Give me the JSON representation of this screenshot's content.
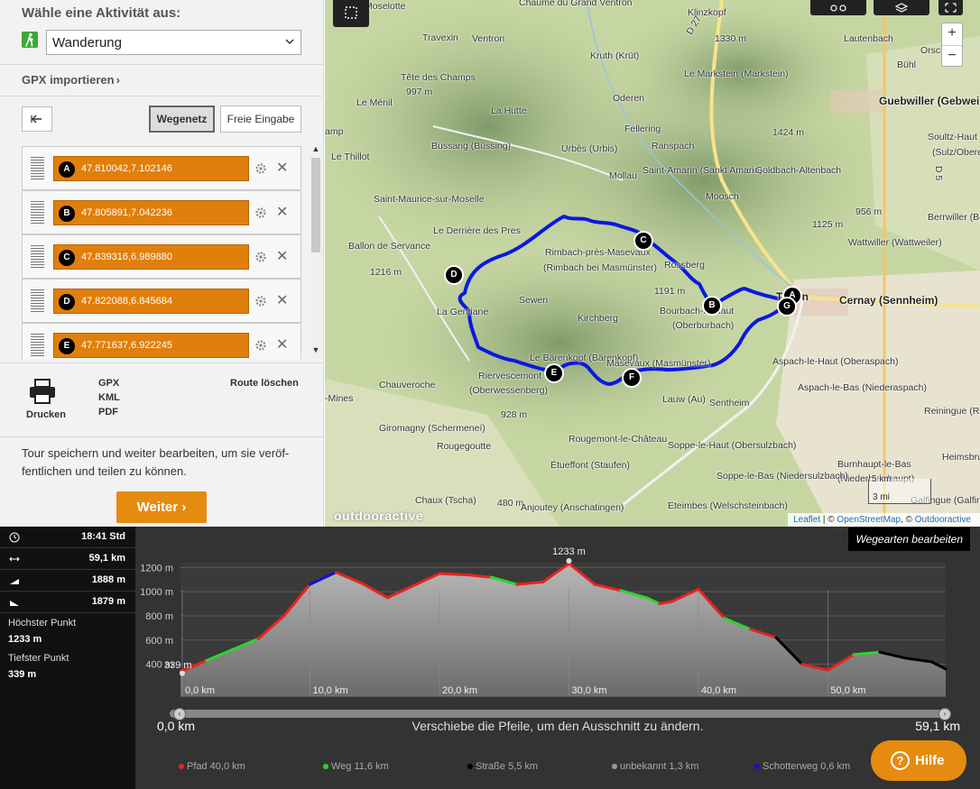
{
  "activity": {
    "title": "Wähle eine Aktivität aus:",
    "selected": "Wanderung"
  },
  "gpx_import": "GPX importieren",
  "routing": {
    "mode_network": "Wegenetz",
    "mode_free": "Freie Eingabe"
  },
  "waypoints": [
    {
      "letter": "A",
      "coord": "47.810042,7.102146"
    },
    {
      "letter": "B",
      "coord": "47.805891,7.042236"
    },
    {
      "letter": "C",
      "coord": "47.839316,6.989880"
    },
    {
      "letter": "D",
      "coord": "47.822088,6.845684"
    },
    {
      "letter": "E",
      "coord": "47.771637,6.922245"
    }
  ],
  "actions": {
    "print": "Drucken",
    "gpx": "GPX",
    "kml": "KML",
    "pdf": "PDF",
    "delete_route": "Route löschen"
  },
  "save": {
    "text": "Tour speichern und weiter bearbeiten, um sie veröf-fentlichen und teilen zu können.",
    "button": "Weiter ›"
  },
  "map": {
    "labels": [
      {
        "t": "Moselotte"
      },
      {
        "t": "Chaume du Grand Ventron"
      },
      {
        "t": "Klinzkopf"
      },
      {
        "t": "1330 m"
      },
      {
        "t": "Travexin"
      },
      {
        "t": "Ventron"
      },
      {
        "t": "Kruth (Krüt)"
      },
      {
        "t": "Lautenbach"
      },
      {
        "t": "Orsch"
      },
      {
        "t": "Le Markstein (Markstein)"
      },
      {
        "t": "Bühl"
      },
      {
        "t": "Tête des Champs"
      },
      {
        "t": "997 m"
      },
      {
        "t": "Le Ménil"
      },
      {
        "t": "La Hutte"
      },
      {
        "t": "Oderen"
      },
      {
        "t": "Guebwiller (Gebweil"
      },
      {
        "t": "Fellering"
      },
      {
        "t": "amp"
      },
      {
        "t": "1424 m"
      },
      {
        "t": "Soultz-Haut"
      },
      {
        "t": "(Sulz/Oberel"
      },
      {
        "t": "Bussang (Büssing)"
      },
      {
        "t": "Urbès (Urbis)"
      },
      {
        "t": "Ranspach"
      },
      {
        "t": "Le Thillot"
      },
      {
        "t": "Mollau"
      },
      {
        "t": "Saint-Amarin (Sankt Amarin)"
      },
      {
        "t": "Goldbach-Altenbach"
      },
      {
        "t": "Saint-Maurice-sur-Moselle"
      },
      {
        "t": "Moosch"
      },
      {
        "t": "956 m"
      },
      {
        "t": "1125 m"
      },
      {
        "t": "Berrwiller (Berrwei"
      },
      {
        "t": "Le Derrière des Pres"
      },
      {
        "t": "Wattwiller (Wattweiler)"
      },
      {
        "t": "Ballon de Servance"
      },
      {
        "t": "Rimbach-près-Masevaux"
      },
      {
        "t": "(Rimbach bei Masmünster)"
      },
      {
        "t": "1216 m"
      },
      {
        "t": "Rossberg"
      },
      {
        "t": "1191 m"
      },
      {
        "t": "Thann"
      },
      {
        "t": "Cernay (Sennheim)"
      },
      {
        "t": "Sewen"
      },
      {
        "t": "La Gentiane"
      },
      {
        "t": "Bourbach-le-Haut"
      },
      {
        "t": "(Oberburbach)"
      },
      {
        "t": "Kirchberg"
      },
      {
        "t": "Le Bärenkopf (Bärenkopf)"
      },
      {
        "t": "Masevaux (Masmünster)"
      },
      {
        "t": "Aspach-le-Haut (Oberaspach)"
      },
      {
        "t": "Riervescemont"
      },
      {
        "t": "(Oberwessenberg)"
      },
      {
        "t": "Chauveroche"
      },
      {
        "t": "Aspach-le-Bas (Niederaspach)"
      },
      {
        "t": "Lauw (Au)"
      },
      {
        "t": "Sentheim"
      },
      {
        "t": "-Mines"
      },
      {
        "t": "Reiningue (Rei"
      },
      {
        "t": "928 m"
      },
      {
        "t": "Giromagny (Schermeneí)"
      },
      {
        "t": "Rougemont-le-Château"
      },
      {
        "t": "Soppe-le-Haut (Obersulzbach)"
      },
      {
        "t": "Rougegoutte"
      },
      {
        "t": "Heimsbrun"
      },
      {
        "t": "Étueffont (Staufen)"
      },
      {
        "t": "Burnhaupt-le-Bas"
      },
      {
        "t": "(Niederburnhaupt)"
      },
      {
        "t": "Soppe-le-Bas (Niedersulzbach)"
      },
      {
        "t": "Chaux (Tscha)"
      },
      {
        "t": "480 m"
      },
      {
        "t": "Galfingue (Galfin"
      },
      {
        "t": "Anjoutey (Anschatingen)"
      },
      {
        "t": "Eteimbes (Welschsteinbach)"
      },
      {
        "t": "D 27"
      },
      {
        "t": "D 5"
      }
    ],
    "markers": [
      "A",
      "B",
      "C",
      "D",
      "E",
      "F",
      "G"
    ],
    "zoom_in": "+",
    "zoom_out": "−",
    "scale": "3 mi",
    "scale_km": "5 km",
    "logo": "outdooractive",
    "attribution": {
      "leaflet": "Leaflet",
      "sep1": " | © ",
      "osm": "OpenStreetMap",
      "sep2": ", © ",
      "oa": "Outdooractive"
    }
  },
  "stats": {
    "duration": "18:41 Std",
    "distance": "59,1 km",
    "ascent": "1888 m",
    "descent": "1879 m",
    "highest_label": "Höchster Punkt",
    "highest": "1233 m",
    "lowest_label": "Tiefster Punkt",
    "lowest": "339 m"
  },
  "elevation": {
    "edit_button": "Wegearten bearbeiten",
    "y_ticks": [
      "1200 m",
      "1000 m",
      "800 m",
      "600 m",
      "400 m"
    ],
    "x_ticks": [
      "0,0 km",
      "10,0 km",
      "20,0 km",
      "30,0 km",
      "40,0 km",
      "50,0 km"
    ],
    "max_label": "1233 m",
    "min_label": "339 m",
    "range_start": "0,0 km",
    "range_end": "59,1 km",
    "range_hint": "Verschiebe die Pfeile, um den Ausschnitt zu ändern.",
    "legend": [
      {
        "label": "Pfad 40,0 km",
        "color": "#e8231f"
      },
      {
        "label": "Weg 11,6 km",
        "color": "#2fd32f"
      },
      {
        "label": "Straße 5,5 km",
        "color": "#000000"
      },
      {
        "label": "unbekannt 1,3 km",
        "color": "#999999"
      },
      {
        "label": "Schotterweg 0,6 km",
        "color": "#1010d0"
      }
    ],
    "help": "Hilfe",
    "help_icon": "?",
    "chart_data": {
      "type": "area",
      "x": [
        0,
        2,
        4,
        6,
        8,
        10,
        12,
        14,
        16,
        18,
        20,
        22,
        24,
        26,
        28,
        30,
        32,
        34,
        36,
        37,
        38,
        40,
        42,
        44,
        46,
        48,
        50,
        52,
        54,
        56,
        58,
        59.1
      ],
      "values": [
        339,
        430,
        520,
        610,
        800,
        1060,
        1160,
        1070,
        950,
        1050,
        1150,
        1140,
        1120,
        1060,
        1080,
        1233,
        1060,
        1010,
        950,
        900,
        920,
        1020,
        780,
        690,
        620,
        400,
        350,
        480,
        500,
        450,
        420,
        360
      ],
      "xlabel": "",
      "ylabel": "",
      "xlim": [
        0,
        59.1
      ],
      "ylim": [
        339,
        1233
      ],
      "grid": true,
      "legend_position": "bottom"
    }
  }
}
